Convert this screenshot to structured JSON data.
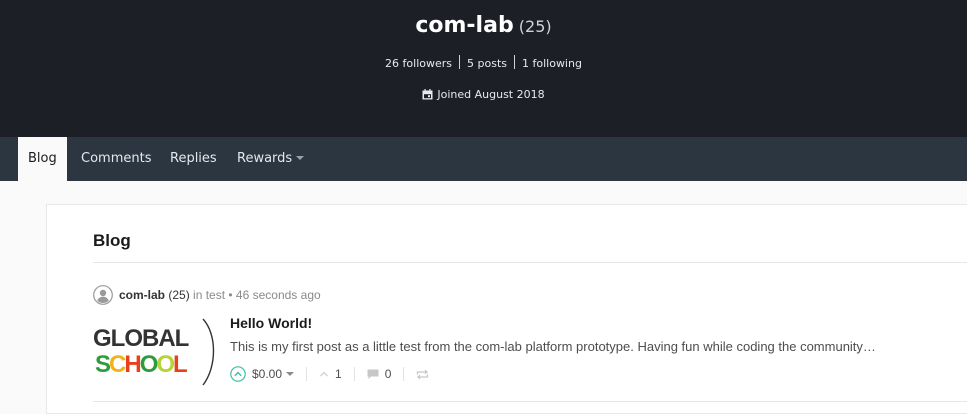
{
  "profile": {
    "name": "com-lab",
    "reputation": "(25)",
    "followers": "26 followers",
    "posts": "5 posts",
    "following": "1 following",
    "joined": "Joined August 2018",
    "icons": {
      "calendar": "calendar-icon"
    },
    "colors": {
      "hero_bg": "#1c2026",
      "nav_bg": "#2c3640"
    }
  },
  "nav": {
    "tabs": [
      {
        "label": "Blog",
        "active": true
      },
      {
        "label": "Comments"
      },
      {
        "label": "Replies"
      },
      {
        "label": "Rewards"
      }
    ]
  },
  "blog": {
    "heading": "Blog",
    "post": {
      "author": "com-lab",
      "author_rep": "(25)",
      "meta_rest": "in test • 46 seconds ago",
      "thumbnail_alt": "GLOBAL SCHOOL",
      "title": "Hello World!",
      "excerpt": "This is my first post as a little test from the com-lab platform prototype. Having fun while coding the community…",
      "payout": "$0.00",
      "votes": "1",
      "comments": "0",
      "icons": [
        "upvote-icon",
        "chevron-up-icon",
        "comment-icon",
        "reblog-icon",
        "avatar-icon"
      ]
    }
  }
}
